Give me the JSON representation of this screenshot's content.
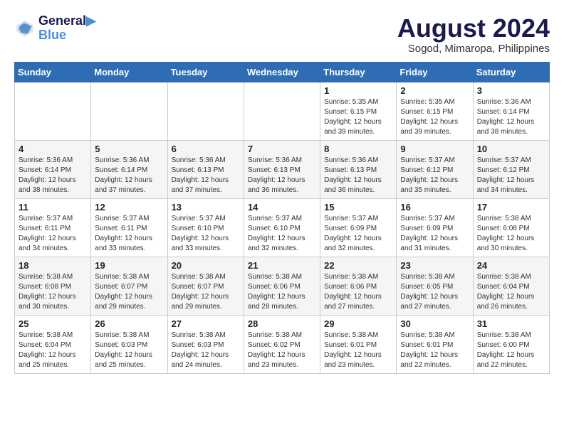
{
  "header": {
    "logo_line1": "General",
    "logo_line2": "Blue",
    "month_title": "August 2024",
    "location": "Sogod, Mimaropa, Philippines"
  },
  "weekdays": [
    "Sunday",
    "Monday",
    "Tuesday",
    "Wednesday",
    "Thursday",
    "Friday",
    "Saturday"
  ],
  "weeks": [
    [
      {
        "day": "",
        "info": ""
      },
      {
        "day": "",
        "info": ""
      },
      {
        "day": "",
        "info": ""
      },
      {
        "day": "",
        "info": ""
      },
      {
        "day": "1",
        "info": "Sunrise: 5:35 AM\nSunset: 6:15 PM\nDaylight: 12 hours\nand 39 minutes."
      },
      {
        "day": "2",
        "info": "Sunrise: 5:35 AM\nSunset: 6:15 PM\nDaylight: 12 hours\nand 39 minutes."
      },
      {
        "day": "3",
        "info": "Sunrise: 5:36 AM\nSunset: 6:14 PM\nDaylight: 12 hours\nand 38 minutes."
      }
    ],
    [
      {
        "day": "4",
        "info": "Sunrise: 5:36 AM\nSunset: 6:14 PM\nDaylight: 12 hours\nand 38 minutes."
      },
      {
        "day": "5",
        "info": "Sunrise: 5:36 AM\nSunset: 6:14 PM\nDaylight: 12 hours\nand 37 minutes."
      },
      {
        "day": "6",
        "info": "Sunrise: 5:36 AM\nSunset: 6:13 PM\nDaylight: 12 hours\nand 37 minutes."
      },
      {
        "day": "7",
        "info": "Sunrise: 5:36 AM\nSunset: 6:13 PM\nDaylight: 12 hours\nand 36 minutes."
      },
      {
        "day": "8",
        "info": "Sunrise: 5:36 AM\nSunset: 6:13 PM\nDaylight: 12 hours\nand 36 minutes."
      },
      {
        "day": "9",
        "info": "Sunrise: 5:37 AM\nSunset: 6:12 PM\nDaylight: 12 hours\nand 35 minutes."
      },
      {
        "day": "10",
        "info": "Sunrise: 5:37 AM\nSunset: 6:12 PM\nDaylight: 12 hours\nand 34 minutes."
      }
    ],
    [
      {
        "day": "11",
        "info": "Sunrise: 5:37 AM\nSunset: 6:11 PM\nDaylight: 12 hours\nand 34 minutes."
      },
      {
        "day": "12",
        "info": "Sunrise: 5:37 AM\nSunset: 6:11 PM\nDaylight: 12 hours\nand 33 minutes."
      },
      {
        "day": "13",
        "info": "Sunrise: 5:37 AM\nSunset: 6:10 PM\nDaylight: 12 hours\nand 33 minutes."
      },
      {
        "day": "14",
        "info": "Sunrise: 5:37 AM\nSunset: 6:10 PM\nDaylight: 12 hours\nand 32 minutes."
      },
      {
        "day": "15",
        "info": "Sunrise: 5:37 AM\nSunset: 6:09 PM\nDaylight: 12 hours\nand 32 minutes."
      },
      {
        "day": "16",
        "info": "Sunrise: 5:37 AM\nSunset: 6:09 PM\nDaylight: 12 hours\nand 31 minutes."
      },
      {
        "day": "17",
        "info": "Sunrise: 5:38 AM\nSunset: 6:08 PM\nDaylight: 12 hours\nand 30 minutes."
      }
    ],
    [
      {
        "day": "18",
        "info": "Sunrise: 5:38 AM\nSunset: 6:08 PM\nDaylight: 12 hours\nand 30 minutes."
      },
      {
        "day": "19",
        "info": "Sunrise: 5:38 AM\nSunset: 6:07 PM\nDaylight: 12 hours\nand 29 minutes."
      },
      {
        "day": "20",
        "info": "Sunrise: 5:38 AM\nSunset: 6:07 PM\nDaylight: 12 hours\nand 29 minutes."
      },
      {
        "day": "21",
        "info": "Sunrise: 5:38 AM\nSunset: 6:06 PM\nDaylight: 12 hours\nand 28 minutes."
      },
      {
        "day": "22",
        "info": "Sunrise: 5:38 AM\nSunset: 6:06 PM\nDaylight: 12 hours\nand 27 minutes."
      },
      {
        "day": "23",
        "info": "Sunrise: 5:38 AM\nSunset: 6:05 PM\nDaylight: 12 hours\nand 27 minutes."
      },
      {
        "day": "24",
        "info": "Sunrise: 5:38 AM\nSunset: 6:04 PM\nDaylight: 12 hours\nand 26 minutes."
      }
    ],
    [
      {
        "day": "25",
        "info": "Sunrise: 5:38 AM\nSunset: 6:04 PM\nDaylight: 12 hours\nand 25 minutes."
      },
      {
        "day": "26",
        "info": "Sunrise: 5:38 AM\nSunset: 6:03 PM\nDaylight: 12 hours\nand 25 minutes."
      },
      {
        "day": "27",
        "info": "Sunrise: 5:38 AM\nSunset: 6:03 PM\nDaylight: 12 hours\nand 24 minutes."
      },
      {
        "day": "28",
        "info": "Sunrise: 5:38 AM\nSunset: 6:02 PM\nDaylight: 12 hours\nand 23 minutes."
      },
      {
        "day": "29",
        "info": "Sunrise: 5:38 AM\nSunset: 6:01 PM\nDaylight: 12 hours\nand 23 minutes."
      },
      {
        "day": "30",
        "info": "Sunrise: 5:38 AM\nSunset: 6:01 PM\nDaylight: 12 hours\nand 22 minutes."
      },
      {
        "day": "31",
        "info": "Sunrise: 5:38 AM\nSunset: 6:00 PM\nDaylight: 12 hours\nand 22 minutes."
      }
    ]
  ]
}
